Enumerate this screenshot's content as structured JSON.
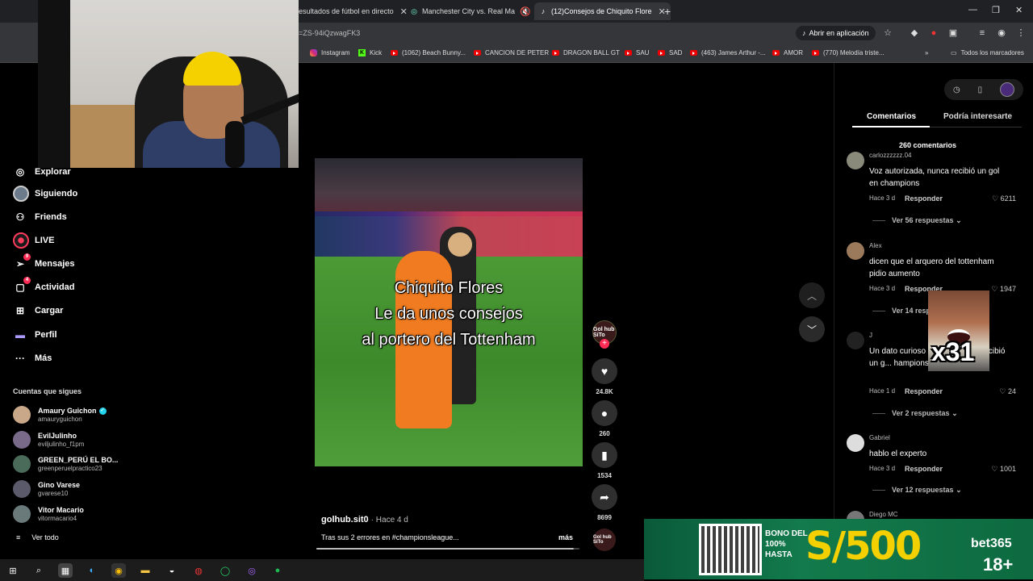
{
  "browser": {
    "tabs": [
      {
        "label": "esultados de fútbol en directo",
        "icon": "soccer-icon"
      },
      {
        "label": "Manchester City vs. Real Ma",
        "icon": "soccer-icon"
      },
      {
        "label": "(12)Consejos de Chiquito Flore",
        "icon": "tiktok-icon"
      }
    ],
    "url": "=ZS-94iQzwagFK3",
    "open_app_label": "Abrir en aplicación",
    "bookmarks": [
      {
        "label": "Instagram",
        "type": "instagram"
      },
      {
        "label": "Kick",
        "type": "kick"
      },
      {
        "label": "(1062) Beach Bunny...",
        "type": "youtube"
      },
      {
        "label": "CANCION DE PETER",
        "type": "youtube"
      },
      {
        "label": "DRAGON BALL GT",
        "type": "youtube"
      },
      {
        "label": "SAU",
        "type": "youtube"
      },
      {
        "label": "SAD",
        "type": "youtube"
      },
      {
        "label": "(463) James Arthur -...",
        "type": "youtube"
      },
      {
        "label": "AMOR",
        "type": "youtube"
      },
      {
        "label": "(770) Melodía triste...",
        "type": "youtube"
      }
    ],
    "all_bookmarks_label": "Todos los marcadores"
  },
  "sidebar": {
    "items": [
      {
        "label": "Explorar",
        "icon": "compass-icon"
      },
      {
        "label": "Siguiendo",
        "icon": "avatar"
      },
      {
        "label": "Friends",
        "icon": "friends-icon"
      },
      {
        "label": "LIVE",
        "icon": "live-icon"
      },
      {
        "label": "Mensajes",
        "icon": "send-icon",
        "badge": "9"
      },
      {
        "label": "Actividad",
        "icon": "activity-icon",
        "badge": "4"
      },
      {
        "label": "Cargar",
        "icon": "upload-icon"
      },
      {
        "label": "Perfil",
        "icon": "profile-icon"
      },
      {
        "label": "Más",
        "icon": "more-icon"
      }
    ],
    "following_title": "Cuentas que sigues",
    "following": [
      {
        "name": "Amaury Guichon",
        "handle": "amauryguichon",
        "verified": true,
        "color": "#c9a889"
      },
      {
        "name": "EvilJulinho",
        "handle": "eviljulinho_f1pm",
        "verified": false,
        "color": "#7a6a8a"
      },
      {
        "name": "GREEN_PERÚ EL BO...",
        "handle": "greenperuelpractico23",
        "verified": false,
        "color": "#4a6a5a"
      },
      {
        "name": "Gino Varese",
        "handle": "gvarese10",
        "verified": false,
        "color": "#5a5a6a"
      },
      {
        "name": "Vitor Macario",
        "handle": "vitormacario4",
        "verified": false,
        "color": "#6a7a7a"
      }
    ],
    "see_all": "Ver todo"
  },
  "video": {
    "caption_lines": [
      "Chiquito Flores",
      "Le da unos consejos",
      "al portero del Tottenham"
    ],
    "author": "golhub.sit0",
    "time": "· Hace 4 d",
    "description": "Tras sus 2 errores en #championsleague...",
    "more": "más",
    "progress": 0.98,
    "creator_avatar_text": "Gol hub SiTo",
    "likes": "24.8K",
    "comments": "260",
    "saves": "1534",
    "shares": "8699"
  },
  "comments_panel": {
    "tabs": [
      "Comentarios",
      "Podría interesarte"
    ],
    "count_label": "260 comentarios",
    "reply_label": "Responder",
    "comments": [
      {
        "user": "carlozzzzzz.04",
        "text": "Voz autorizada, nunca recibió un gol en champions",
        "time": "Hace 3 d",
        "likes": "6211",
        "replies": "Ver 56 respuestas",
        "color": "#8a8a7a"
      },
      {
        "user": "Alex",
        "text": "dicen que el arquero del tottenham pidio aumento",
        "time": "Hace 3 d",
        "likes": "1947",
        "replies": "Ver 14 resp",
        "color": "#9a7a5a"
      },
      {
        "user": "J",
        "text": "Un dato curioso a ... res nunca recibió un g... hampions 💀💀",
        "time": "Hace 1 d",
        "likes": "24",
        "replies": "Ver 2 respuestas",
        "color": "#222"
      },
      {
        "user": "Gabriel",
        "text": "hablo el experto",
        "time": "Hace 3 d",
        "likes": "1001",
        "replies": "Ver 12 respuestas",
        "color": "#ddd"
      },
      {
        "user": "Diego MC",
        "text": "",
        "time": "",
        "likes": "",
        "replies": "",
        "color": "#777"
      }
    ],
    "meme_text": "x31"
  },
  "ad": {
    "bono_lines": [
      "BONO DEL",
      "100%",
      "HASTA"
    ],
    "amount": "S/500",
    "brand": "bet365",
    "age": "18+"
  }
}
